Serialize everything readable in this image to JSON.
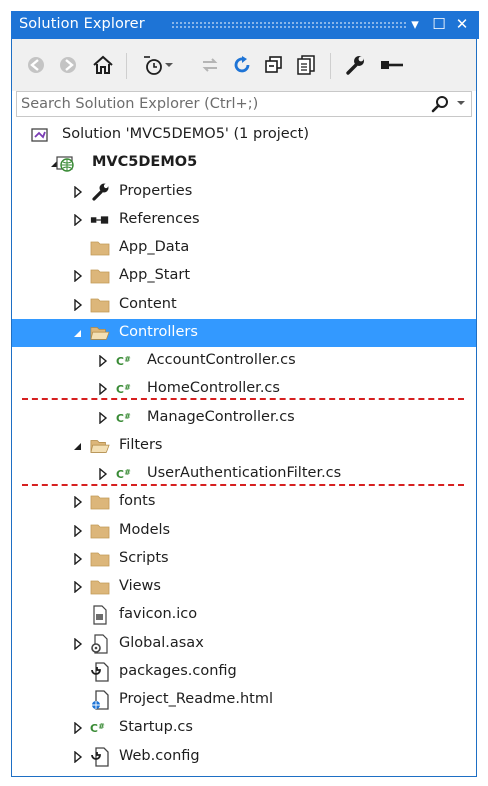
{
  "window": {
    "title": "Solution Explorer"
  },
  "title_buttons": {
    "dropdown": "▾",
    "maximize": "☐",
    "close": "✕"
  },
  "toolbar": {
    "buttons": [
      "back-icon",
      "forward-icon",
      "home-icon",
      "pending-changes-filter-icon",
      "sync-active-document-icon",
      "refresh-icon",
      "collapse-all-icon",
      "show-all-files-icon",
      "properties-icon",
      "preview-selected-items-icon"
    ]
  },
  "search": {
    "placeholder": "Search Solution Explorer (Ctrl+;)"
  },
  "tree": [
    {
      "label": "Solution 'MVC5DEMO5' (1 project)",
      "icon": "solution-icon",
      "indent": 0,
      "expander": "none"
    },
    {
      "label": "MVC5DEMO5",
      "icon": "web-project-icon",
      "indent": 1,
      "expander": "expanded",
      "bold": true
    },
    {
      "label": "Properties",
      "icon": "wrench-icon",
      "indent": 2,
      "expander": "collapsed"
    },
    {
      "label": "References",
      "icon": "references-icon",
      "indent": 2,
      "expander": "collapsed"
    },
    {
      "label": "App_Data",
      "icon": "folder-icon",
      "indent": 2,
      "expander": "none"
    },
    {
      "label": "App_Start",
      "icon": "folder-icon",
      "indent": 2,
      "expander": "collapsed"
    },
    {
      "label": "Content",
      "icon": "folder-icon",
      "indent": 2,
      "expander": "collapsed"
    },
    {
      "label": "Controllers",
      "icon": "folder-open-icon",
      "indent": 2,
      "expander": "expanded",
      "selected": true
    },
    {
      "label": "AccountController.cs",
      "icon": "csharp-file-icon",
      "indent": 3,
      "expander": "collapsed"
    },
    {
      "label": "HomeController.cs",
      "icon": "csharp-file-icon",
      "indent": 3,
      "expander": "collapsed"
    },
    {
      "label": "ManageController.cs",
      "icon": "csharp-file-icon",
      "indent": 3,
      "expander": "collapsed"
    },
    {
      "label": "Filters",
      "icon": "folder-open-icon",
      "indent": 2,
      "expander": "expanded"
    },
    {
      "label": "UserAuthenticationFilter.cs",
      "icon": "csharp-file-icon",
      "indent": 3,
      "expander": "collapsed"
    },
    {
      "label": "fonts",
      "icon": "folder-icon",
      "indent": 2,
      "expander": "collapsed"
    },
    {
      "label": "Models",
      "icon": "folder-icon",
      "indent": 2,
      "expander": "collapsed"
    },
    {
      "label": "Scripts",
      "icon": "folder-icon",
      "indent": 2,
      "expander": "collapsed"
    },
    {
      "label": "Views",
      "icon": "folder-icon",
      "indent": 2,
      "expander": "collapsed"
    },
    {
      "label": "favicon.ico",
      "icon": "image-file-icon",
      "indent": 2,
      "expander": "none"
    },
    {
      "label": "Global.asax",
      "icon": "global-asax-icon",
      "indent": 2,
      "expander": "collapsed"
    },
    {
      "label": "packages.config",
      "icon": "config-file-icon",
      "indent": 2,
      "expander": "none"
    },
    {
      "label": "Project_Readme.html",
      "icon": "html-file-icon",
      "indent": 2,
      "expander": "none"
    },
    {
      "label": "Startup.cs",
      "icon": "csharp-file-icon",
      "indent": 2,
      "expander": "collapsed"
    },
    {
      "label": "Web.config",
      "icon": "config-file-icon",
      "indent": 2,
      "expander": "collapsed"
    }
  ],
  "colors": {
    "accent": "#1e74d6",
    "selection": "#3399ff",
    "folder": "#dcb67a",
    "csharp": "#388a34",
    "annotation": "#d62020"
  }
}
